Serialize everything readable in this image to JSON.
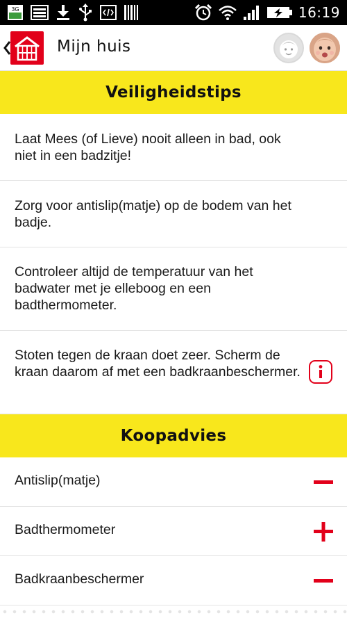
{
  "status_bar": {
    "time": "16:19",
    "network_label": "3G",
    "left_icons": [
      "3g-signal-icon",
      "image-icon",
      "download-icon",
      "usb-icon",
      "code-icon",
      "barcode-icon"
    ],
    "right_icons": [
      "alarm-icon",
      "wifi-icon",
      "signal-icon",
      "battery-charging-icon"
    ]
  },
  "app_bar": {
    "title": "Mijn huis",
    "logo": "house-logo-icon",
    "avatars": [
      "child-avatar-placeholder",
      "baby-avatar-photo"
    ]
  },
  "sections": {
    "tips_title": "Veiligheidstips",
    "buy_title": "Koopadvies"
  },
  "tips": [
    {
      "text": "Laat Mees (of Lieve) nooit alleen in bad, ook niet in een badzitje!"
    },
    {
      "text": "Zorg voor antislip(matje) op de bodem van het badje."
    },
    {
      "text": "Controleer altijd de temperatuur van het badwater met je elleboog en een badthermometer."
    },
    {
      "text": "Stoten tegen de kraan doet zeer. Scherm de kraan daarom af met een badkraanbeschermer.",
      "info_icon": "info-icon"
    }
  ],
  "buy_items": [
    {
      "label": "Antislip(matje)",
      "state": "minus"
    },
    {
      "label": "Badthermometer",
      "state": "plus"
    },
    {
      "label": "Badkraanbeschermer",
      "state": "minus"
    }
  ],
  "colors": {
    "accent_red": "#e2001a",
    "header_yellow": "#f8e71c"
  }
}
